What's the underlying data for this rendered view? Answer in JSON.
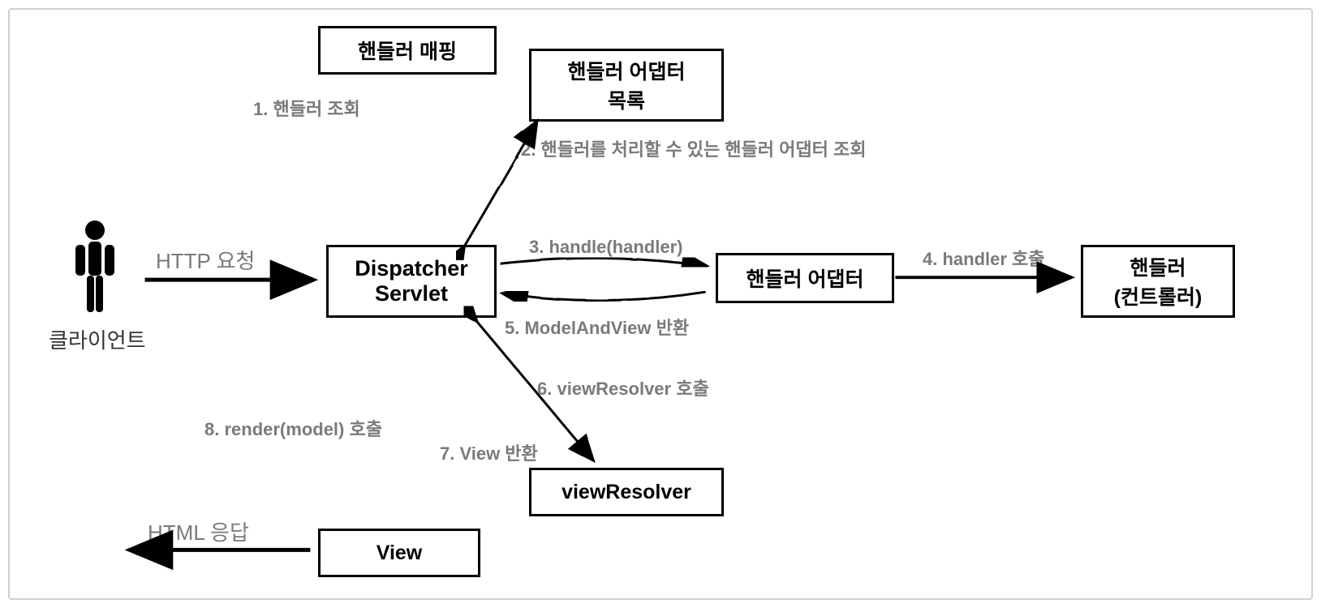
{
  "client_label": "클라이언트",
  "http_request": "HTTP 요청",
  "html_response": "HTML 응답",
  "boxes": {
    "dispatcher": "Dispatcher\nServlet",
    "handler_mapping": "핸들러 매핑",
    "handler_adapter_list": "핸들러 어댑터\n목록",
    "handler_adapter": "핸들러 어댑터",
    "handler_controller": "핸들러\n(컨트롤러)",
    "view_resolver": "viewResolver",
    "view": "View"
  },
  "steps": {
    "s1": "1. 핸들러 조회",
    "s2": "2. 핸들러를 처리할 수 있는 핸들러 어댑터 조회",
    "s3": "3. handle(handler)",
    "s4": "4. handler 호출",
    "s5": "5. ModelAndView 반환",
    "s6": "6. viewResolver 호출",
    "s7": "7. View 반환",
    "s8": "8. render(model) 호출"
  }
}
